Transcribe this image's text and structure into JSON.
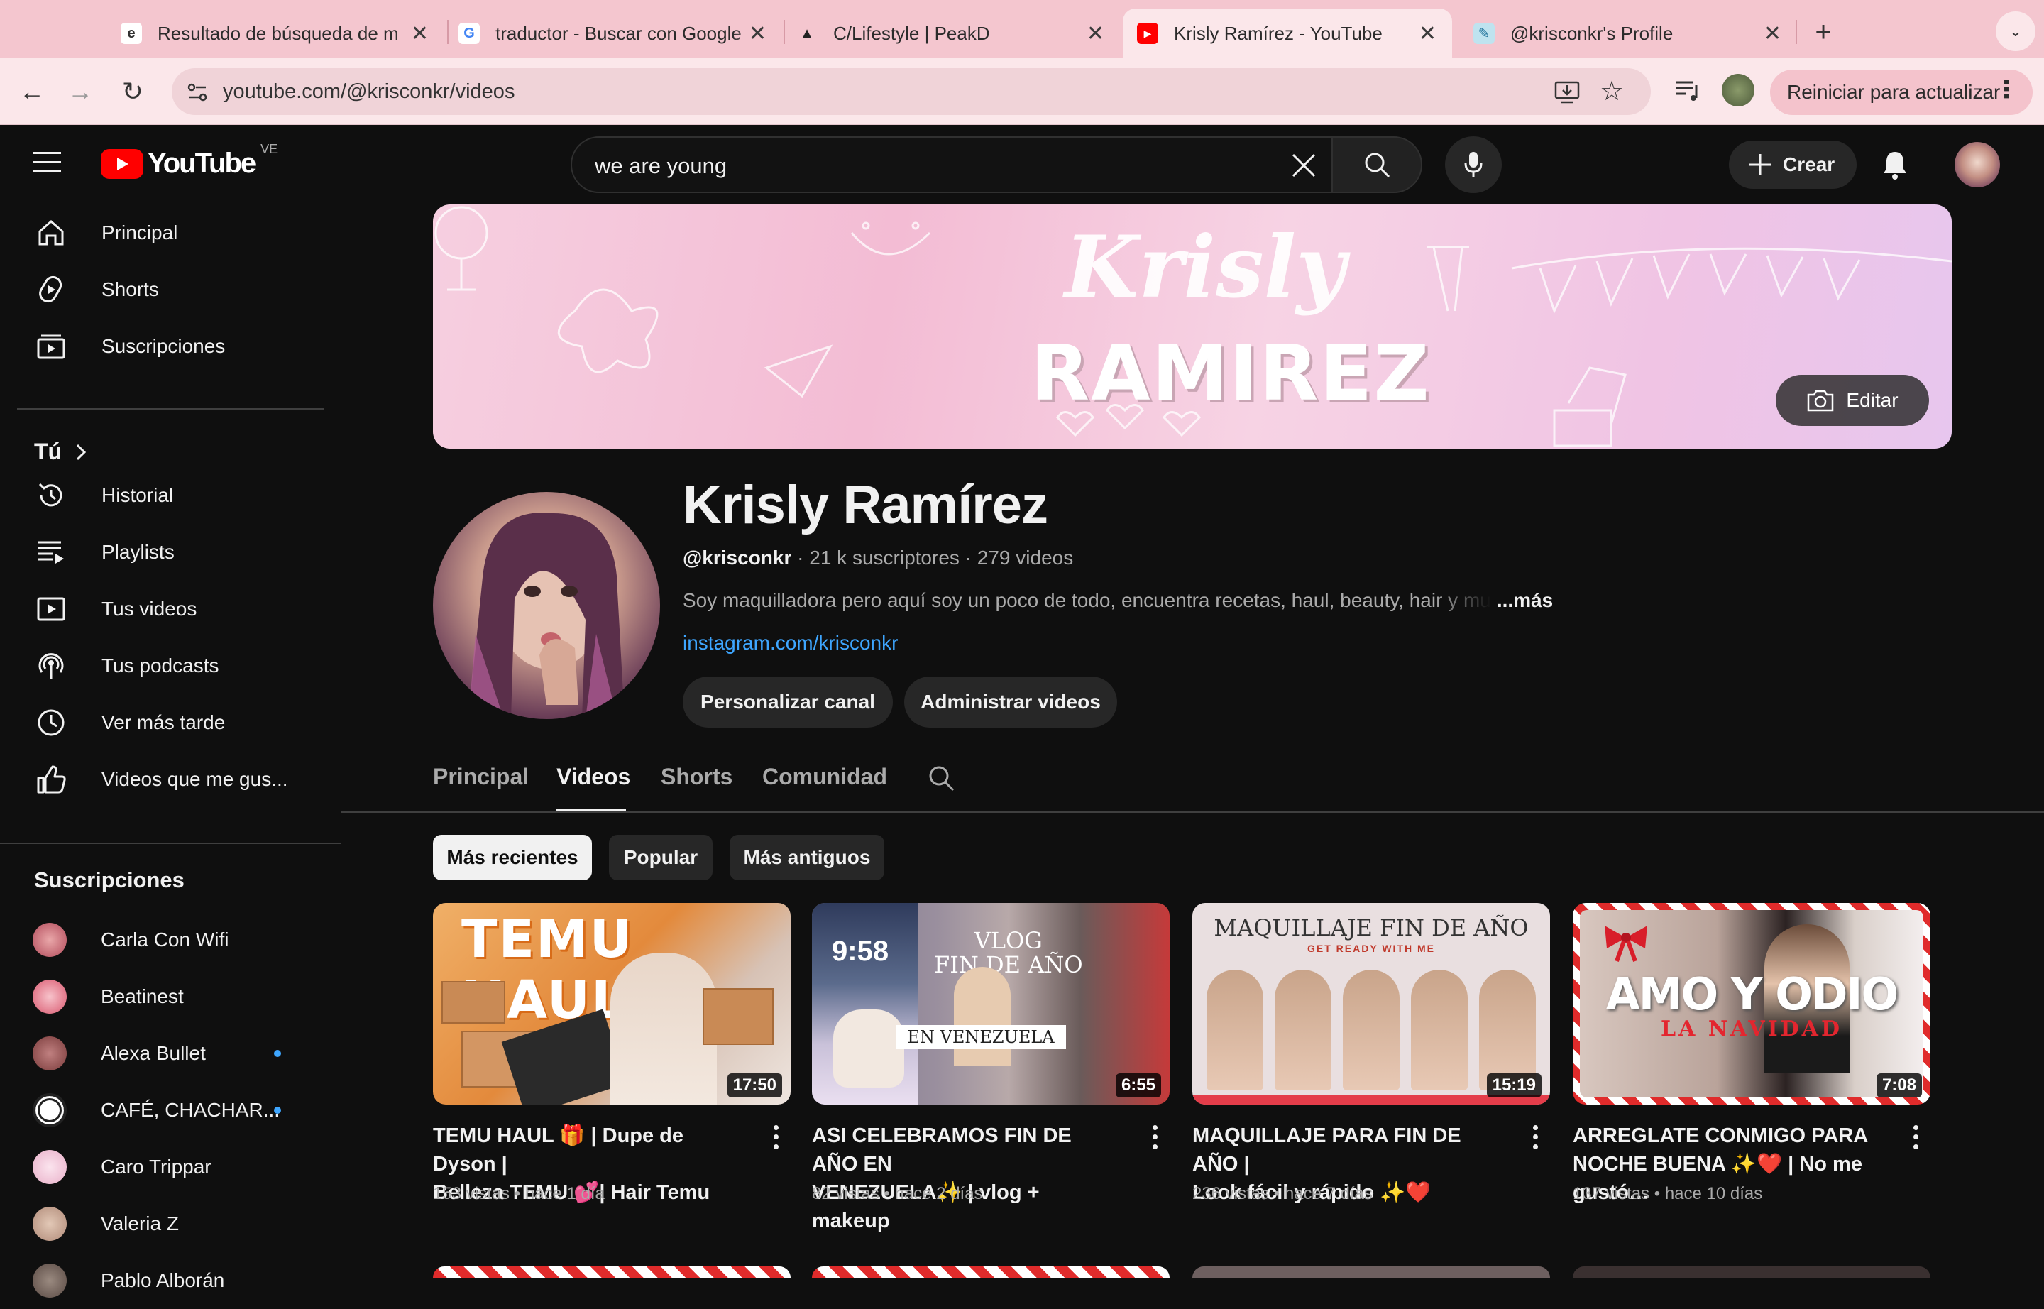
{
  "browser": {
    "tabs": [
      {
        "label": "Resultado de búsqueda de m",
        "favicon": "search-engine-icon"
      },
      {
        "label": "traductor - Buscar con Google",
        "favicon": "google-icon"
      },
      {
        "label": "C/Lifestyle | PeakD",
        "favicon": "peakd-icon"
      },
      {
        "label": "Krisly Ramírez - YouTube",
        "favicon": "youtube-icon",
        "active": true
      },
      {
        "label": "@krisconkr's Profile",
        "favicon": "profile-icon"
      }
    ],
    "url": "youtube.com/@krisconkr/videos",
    "restart_label": "Reiniciar para actualizar"
  },
  "youtube": {
    "logo_text": "YouTube",
    "country": "VE",
    "search_value": "we are young",
    "create_label": "Crear"
  },
  "sidebar": {
    "main": [
      {
        "label": "Principal",
        "icon": "home-icon"
      },
      {
        "label": "Shorts",
        "icon": "shorts-icon"
      },
      {
        "label": "Suscripciones",
        "icon": "subscriptions-icon"
      }
    ],
    "you_label": "Tú",
    "you": [
      {
        "label": "Historial",
        "icon": "history-icon"
      },
      {
        "label": "Playlists",
        "icon": "playlists-icon"
      },
      {
        "label": "Tus videos",
        "icon": "your-videos-icon"
      },
      {
        "label": "Tus podcasts",
        "icon": "podcasts-icon"
      },
      {
        "label": "Ver más tarde",
        "icon": "watch-later-icon"
      },
      {
        "label": "Videos que me gus...",
        "icon": "liked-videos-icon"
      }
    ],
    "subs_title": "Suscripciones",
    "subs": [
      {
        "label": "Carla Con Wifi",
        "color": "#b24a5a",
        "new": false
      },
      {
        "label": "Beatinest",
        "color": "#d9586f",
        "new": false
      },
      {
        "label": "Alexa Bullet",
        "color": "#7a3b3b",
        "new": true
      },
      {
        "label": "CAFÉ, CHACHAR...",
        "color": "#ffffff",
        "new": true
      },
      {
        "label": "Caro Trippar",
        "color": "#e9b0c9",
        "new": false
      },
      {
        "label": "Valeria Z",
        "color": "#b08a78",
        "new": false
      },
      {
        "label": "Pablo Alborán",
        "color": "#5a4a44",
        "new": false
      }
    ]
  },
  "channel": {
    "banner_line1": "Krisly",
    "banner_line2": "RAMIREZ",
    "edit_label": "Editar",
    "name": "Krisly Ramírez",
    "handle": "@krisconkr",
    "subscribers": " · 21 k suscriptores · 279 videos",
    "description": "Soy maquilladora pero aquí soy un poco de todo, encuentra recetas, haul, beauty, hair y mu",
    "more_label": "...más",
    "link": "instagram.com/krisconkr",
    "buttons": [
      "Personalizar canal",
      "Administrar videos"
    ],
    "tabs": [
      "Principal",
      "Videos",
      "Shorts",
      "Comunidad"
    ],
    "active_tab": "Videos",
    "chips": [
      "Más recientes",
      "Popular",
      "Más antiguos"
    ]
  },
  "videos": [
    {
      "title": "TEMU HAUL 🎁 | Dupe de Dyson |\nBelleza TEMU 💕| Hair Temu",
      "duration": "17:50",
      "views": "153 vistas",
      "age": "hace 1 día",
      "thumb_text": "TEMU HAUL",
      "thumb_bg": "#e9a44d"
    },
    {
      "title": "ASI CELEBRAMOS FIN DE AÑO EN\nVENEZUELA✨ | vlog + makeup",
      "duration": "6:55",
      "views": "82 vistas",
      "age": "hace 2 días",
      "thumb_text": "VLOG\nFIN DE AÑO",
      "thumb_text2": "EN VENEZUELA",
      "thumb_time": "9:58",
      "thumb_bg": "#8e7f8f"
    },
    {
      "title": "MAQUILLAJE PARA FIN DE AÑO |\nLook fácil y rápido ✨❤️",
      "duration": "15:19",
      "views": "236 vistas",
      "age": "hace 7 días",
      "thumb_text": "MAQUILLAJE FIN DE AÑO",
      "thumb_text2": "GET READY WITH ME",
      "thumb_bg": "#eadfe0"
    },
    {
      "title": "ARREGLATE CONMIGO PARA\nNOCHE BUENA ✨❤️ | No me gustó…",
      "duration": "7:08",
      "views": "137 vistas",
      "age": "hace 10 días",
      "thumb_text": "AMO Y ODIO",
      "thumb_text2": "LA NAVIDAD",
      "thumb_bg": "#c9b6b0"
    }
  ]
}
